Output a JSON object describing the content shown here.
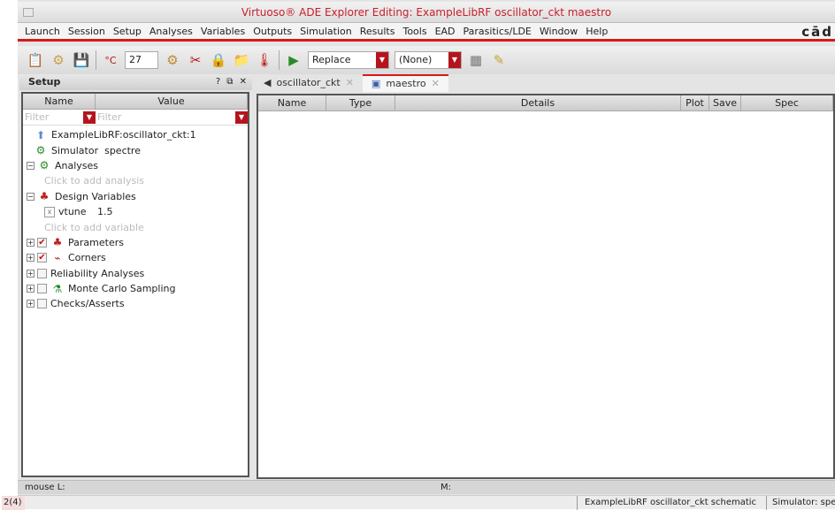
{
  "window": {
    "title": "Virtuoso® ADE Explorer Editing: ExampleLibRF oscillator_ckt maestro",
    "logo": "cād"
  },
  "menu": [
    "Launch",
    "Session",
    "Setup",
    "Analyses",
    "Variables",
    "Outputs",
    "Simulation",
    "Results",
    "Tools",
    "EAD",
    "Parasitics/LDE",
    "Window",
    "Help"
  ],
  "toolbar": {
    "temperature": "27",
    "temp_unit": "°C",
    "run_mode": "Replace",
    "history": "(None)"
  },
  "setup": {
    "title": "Setup",
    "buttons": "? ⧉ ✕",
    "col_name": "Name",
    "col_value": "Value",
    "filter_placeholder": "Filter",
    "items": [
      {
        "label": "ExampleLibRF:oscillator_ckt:1"
      },
      {
        "label": "Simulator",
        "value": "spectre"
      },
      {
        "label": "Analyses"
      },
      {
        "label": "Click to add analysis"
      },
      {
        "label": "Design Variables"
      },
      {
        "label": "vtune",
        "value": "1.5"
      },
      {
        "label": "Click to add variable"
      },
      {
        "label": "Parameters",
        "checked": true
      },
      {
        "label": "Corners",
        "checked": true
      },
      {
        "label": "Reliability Analyses",
        "checked": false
      },
      {
        "label": "Monte Carlo Sampling",
        "checked": false
      },
      {
        "label": "Checks/Asserts",
        "checked": false
      }
    ]
  },
  "tabs": [
    {
      "label": "oscillator_ckt"
    },
    {
      "label": "maestro",
      "active": true
    }
  ],
  "grid": {
    "columns": [
      "Name",
      "Type",
      "Details",
      "Plot",
      "Save",
      "Spec"
    ]
  },
  "status": {
    "mouse_l": "mouse L:",
    "mouse_m": "M:"
  },
  "bottom": {
    "count": "2(4)",
    "cellview": "ExampleLibRF oscillator_ckt schematic",
    "simulator": "Simulator: spe"
  }
}
